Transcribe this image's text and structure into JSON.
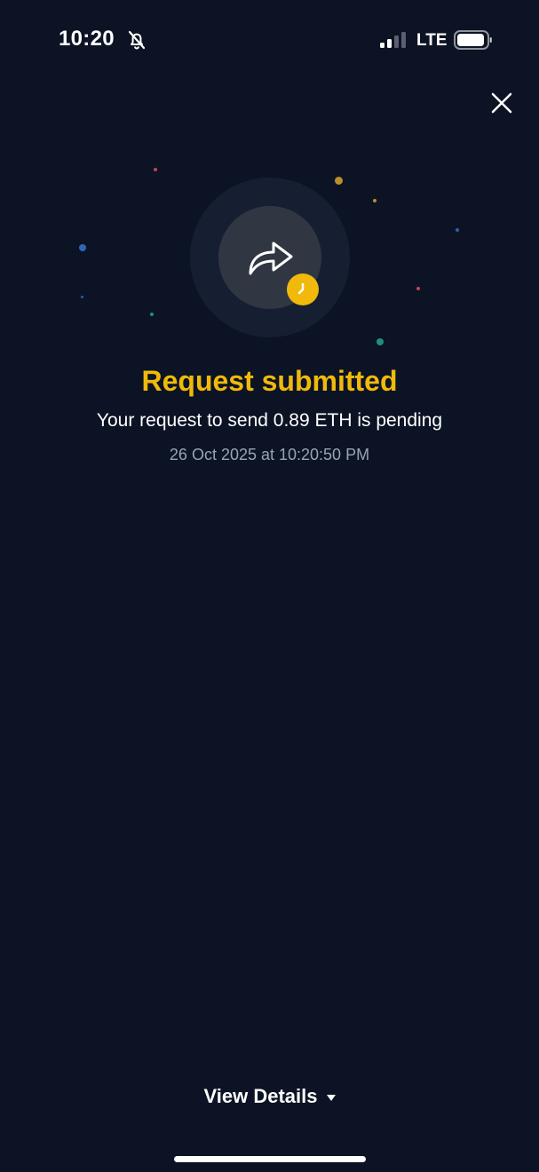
{
  "status_bar": {
    "time": "10:20",
    "network": "LTE",
    "icons": [
      "bell-slash-icon",
      "signal-icon",
      "battery-icon"
    ]
  },
  "close": {
    "icon": "close-icon"
  },
  "hero": {
    "icon": "share-forward-icon",
    "badge_icon": "clock-icon",
    "accent_color": "#f0b90b"
  },
  "message": {
    "title": "Request submitted",
    "subtitle": "Your request to send 0.89 ETH is pending",
    "timestamp": "26 Oct 2025 at 10:20:50 PM"
  },
  "footer": {
    "view_details_label": "View Details",
    "caret_icon": "caret-down-icon"
  },
  "colors": {
    "background": "#0b1324",
    "accent": "#f0b90b",
    "muted_text": "#9aa3b5"
  }
}
